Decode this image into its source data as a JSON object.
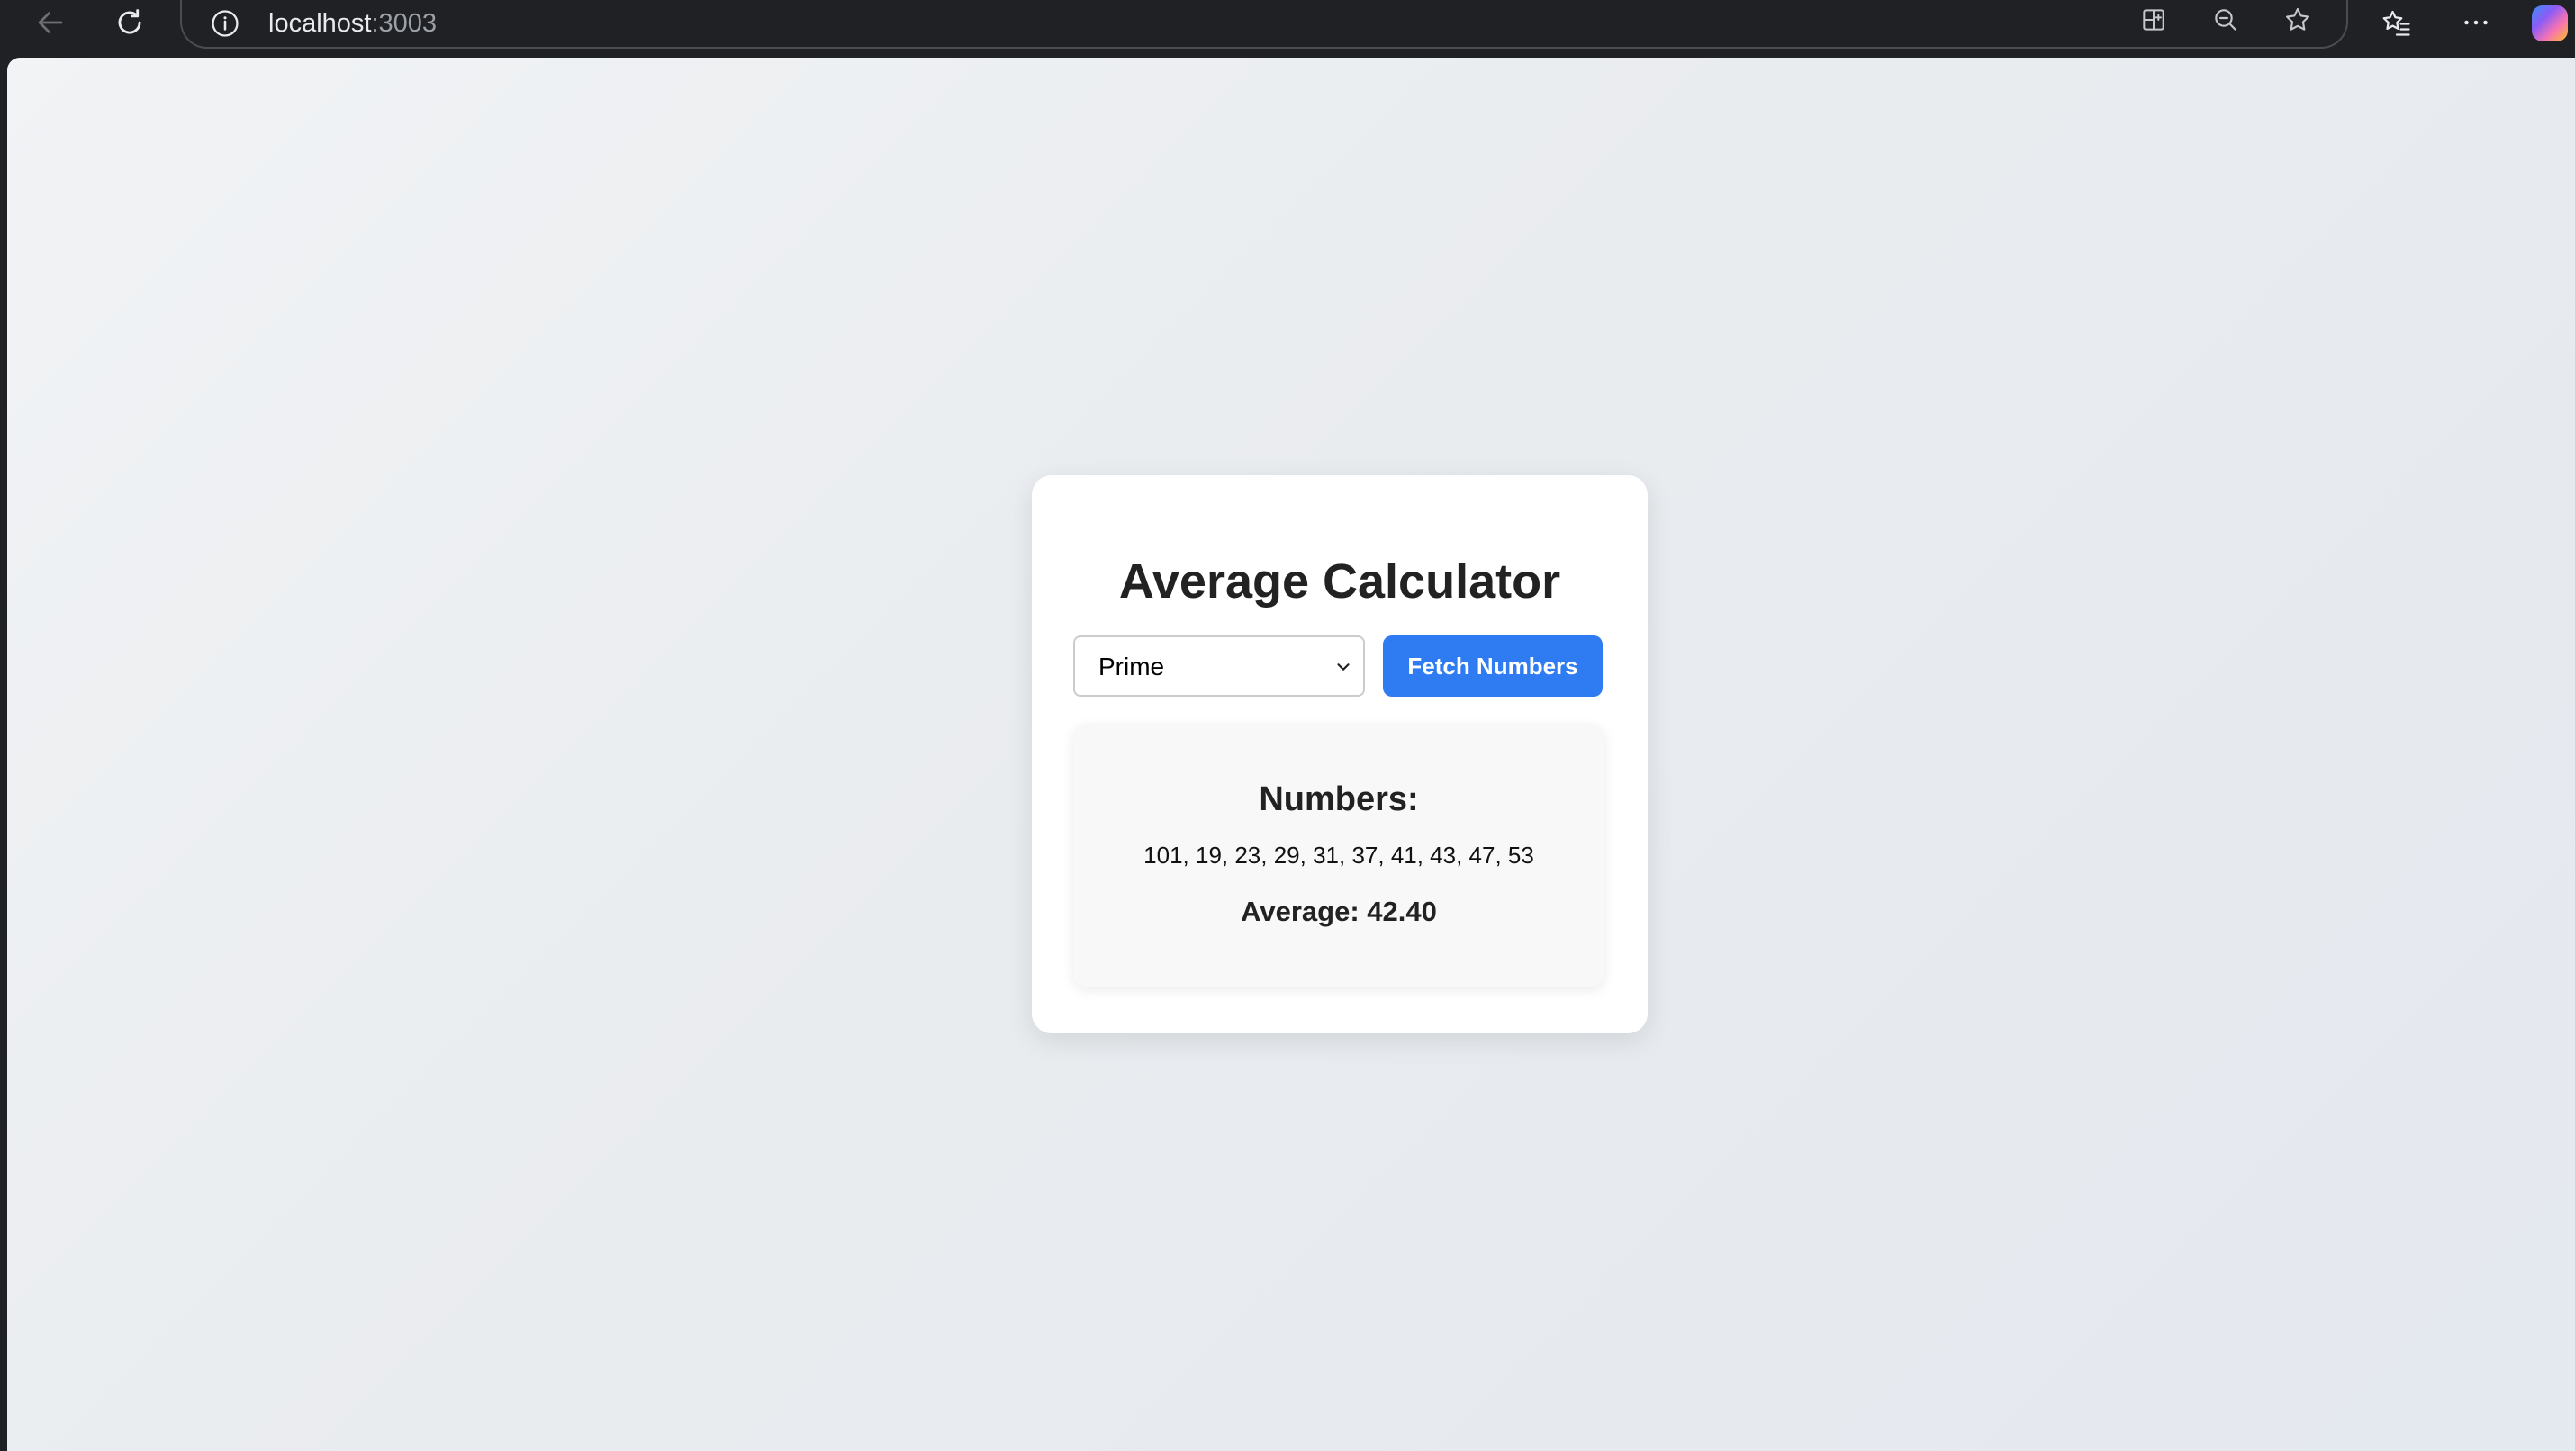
{
  "browser": {
    "url_host": "localhost",
    "url_port": ":3003"
  },
  "app": {
    "title": "Average Calculator",
    "number_type": {
      "selected": "Prime"
    },
    "fetch_button_label": "Fetch Numbers",
    "results": {
      "heading": "Numbers:",
      "numbers_text": "101, 19, 23, 29, 31, 37, 41, 43, 47, 53",
      "average_text": "Average: 42.40"
    },
    "colors": {
      "accent": "#2f7bf2",
      "card_background": "#ffffff",
      "results_background": "#f8f8f8"
    }
  }
}
